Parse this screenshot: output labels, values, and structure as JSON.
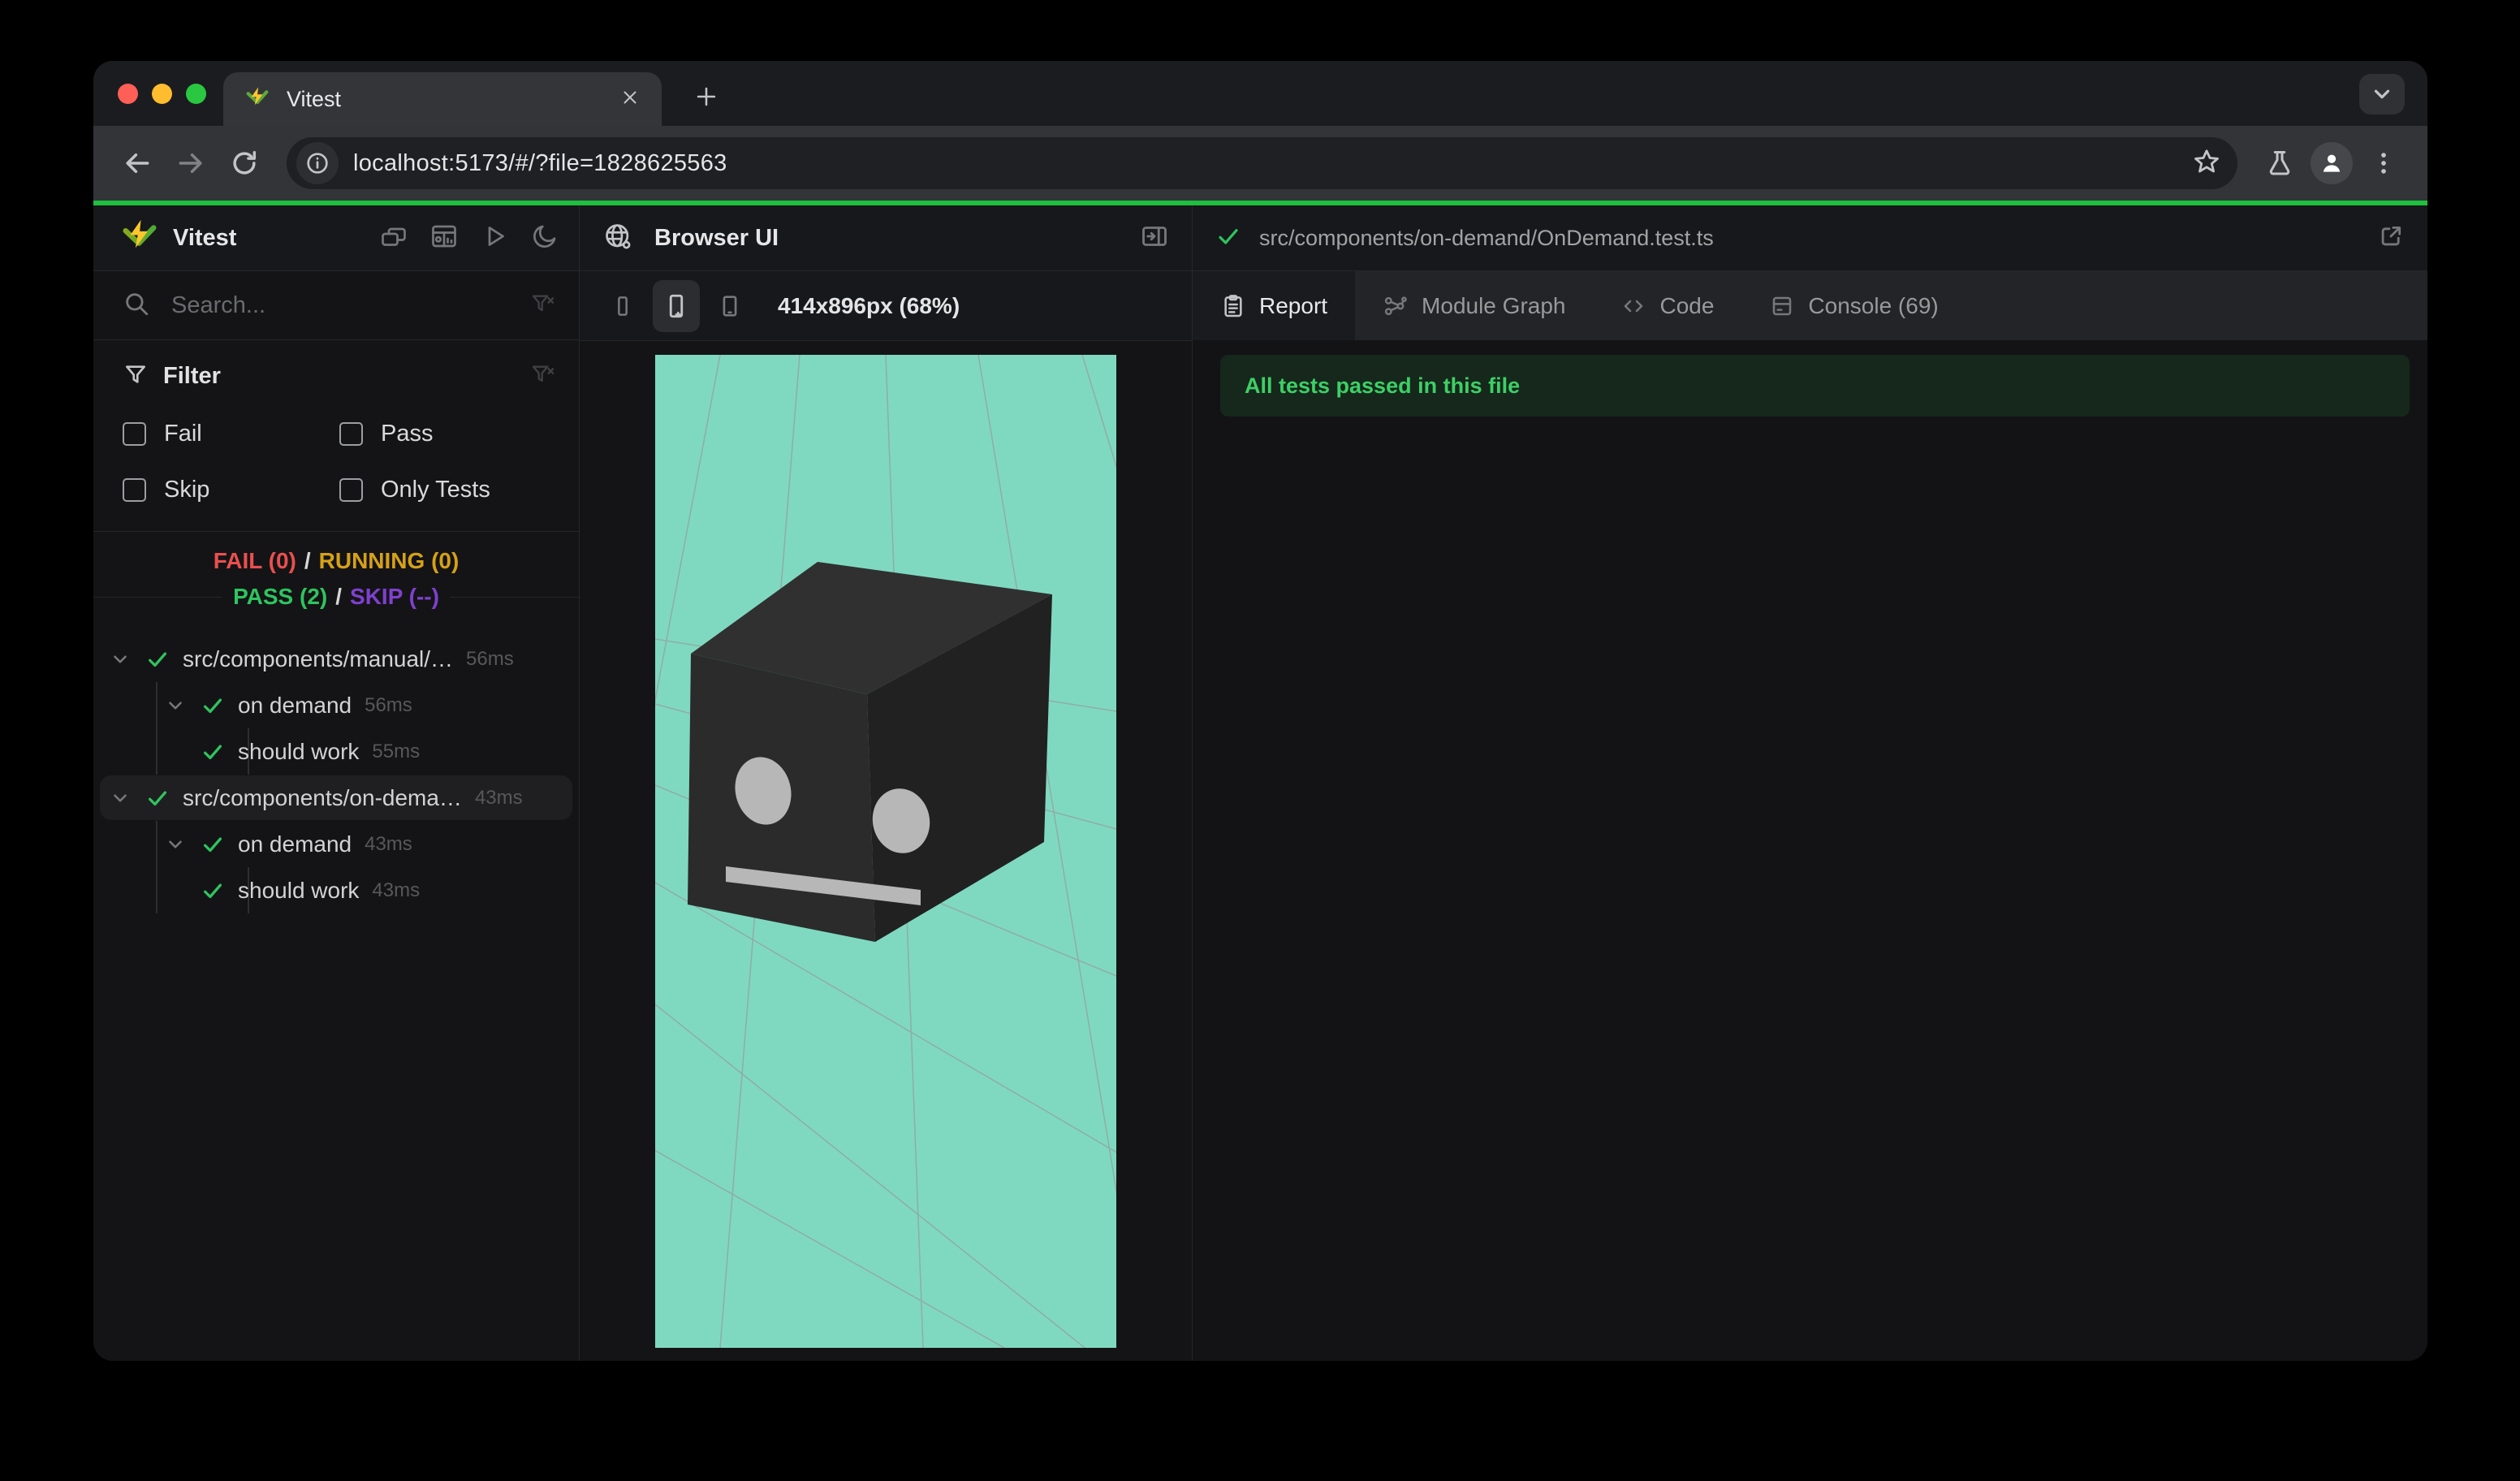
{
  "browser": {
    "tab_title": "Vitest",
    "url": "localhost:5173/#/?file=1828625563"
  },
  "sidebar": {
    "app_title": "Vitest",
    "search_placeholder": "Search...",
    "filter": {
      "label": "Filter",
      "options": [
        "Fail",
        "Pass",
        "Skip",
        "Only Tests"
      ]
    },
    "stats": {
      "fail": "FAIL (0)",
      "running": "RUNNING (0)",
      "pass": "PASS (2)",
      "skip": "SKIP (--)",
      "separator": "/"
    },
    "tree": [
      {
        "label": "src/components/manual/…",
        "duration": "56ms",
        "status": "pass"
      },
      {
        "label": "on demand",
        "duration": "56ms",
        "status": "pass"
      },
      {
        "label": "should work",
        "duration": "55ms",
        "status": "pass"
      },
      {
        "label": "src/components/on-dema…",
        "duration": "43ms",
        "status": "pass"
      },
      {
        "label": "on demand",
        "duration": "43ms",
        "status": "pass"
      },
      {
        "label": "should work",
        "duration": "43ms",
        "status": "pass"
      }
    ]
  },
  "browser_panel": {
    "title": "Browser UI",
    "viewport_size_label": "414x896px (68%)"
  },
  "report_panel": {
    "file_path": "src/components/on-demand/OnDemand.test.ts",
    "tabs": [
      "Report",
      "Module Graph",
      "Code",
      "Console (69)"
    ],
    "banner": "All tests passed in this file"
  },
  "colors": {
    "progress_bar_green": "#1ec13d",
    "pass_green": "#2fc45f",
    "fail_red": "#ea4f4f",
    "running_yellow": "#d5a117",
    "skip_purple": "#8040cf",
    "banner_bg": "#15281b",
    "banner_text": "#3ecf66",
    "viewport_teal": "#7fd9c0",
    "vitest_yellow": "#fcc72b",
    "vitest_green": "#5da93a",
    "traffic_red": "#ff5f57",
    "traffic_yellow": "#febc2e",
    "traffic_green": "#2ac840"
  }
}
